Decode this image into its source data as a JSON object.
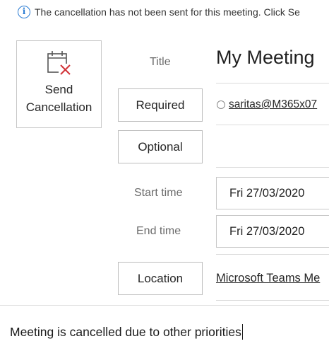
{
  "infobar": {
    "icon": "info-icon",
    "message": "The cancellation has not been sent for this meeting. Click Se"
  },
  "toolbar": {
    "send_cancellation_label": "Send Cancellation",
    "send_cancellation_icon": "calendar-cancel-icon"
  },
  "fields": {
    "title_label": "Title",
    "title_value": "My Meeting",
    "required_label": "Required",
    "required_recipient": "saritas@M365x07",
    "optional_label": "Optional",
    "start_time_label": "Start time",
    "start_date": "Fri 27/03/2020",
    "end_time_label": "End time",
    "end_date": "Fri 27/03/2020",
    "location_label": "Location",
    "location_value": "Microsoft Teams Me"
  },
  "body": {
    "text": "Meeting is cancelled due to other priorities"
  },
  "colors": {
    "info_blue": "#2b7cd3",
    "cancel_red": "#d13438",
    "border_gray": "#c8c8c8"
  }
}
